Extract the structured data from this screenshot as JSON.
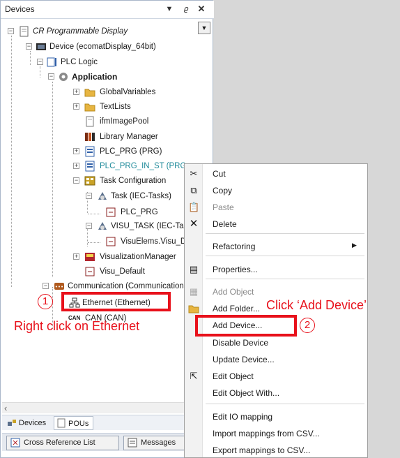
{
  "panel": {
    "title": "Devices",
    "pin_icon": "pin-icon",
    "close_icon": "close-icon",
    "menu_icon": "dropdown-arrow-icon"
  },
  "tree": {
    "root": "CR Programmable Display",
    "device": "Device (ecomatDisplay_64bit)",
    "plc_logic": "PLC Logic",
    "application": "Application",
    "global_vars": "GlobalVariables",
    "textlists": "TextLists",
    "image_pool": "ifmImagePool",
    "library_manager": "Library Manager",
    "plc_prg": "PLC_PRG (PRG)",
    "plc_prg_in_st": "PLC_PRG_IN_ST (PRG)",
    "task_config": "Task Configuration",
    "task": "Task (IEC-Tasks)",
    "task_plc_prg": "PLC_PRG",
    "visu_task": "VISU_TASK (IEC-Tasks)",
    "visu_elems": "VisuElems.Visu_Default",
    "visu_manager": "VisualizationManager",
    "visu_default": "Visu_Default",
    "communication": "Communication (Communication)",
    "ethernet": "Ethernet (Ethernet)",
    "can": "CAN (CAN)"
  },
  "bottom": {
    "tab_devices": "Devices",
    "tab_pous": "POUs",
    "tab_crossref": "Cross Reference List",
    "tab_messages": "Messages"
  },
  "context_menu": {
    "cut": "Cut",
    "copy": "Copy",
    "paste": "Paste",
    "delete": "Delete",
    "refactoring": "Refactoring",
    "properties": "Properties...",
    "add_object": "Add Object",
    "add_folder": "Add Folder...",
    "add_device": "Add Device...",
    "disable_device": "Disable Device",
    "update_device": "Update Device...",
    "edit_object": "Edit Object",
    "edit_object_with": "Edit Object With...",
    "edit_io_mapping": "Edit IO mapping",
    "import_mappings": "Import mappings from CSV...",
    "export_mappings": "Export mappings to CSV..."
  },
  "annotations": {
    "step1_num": "1",
    "step1_text": "Right click on Ethernet",
    "step2_num": "2",
    "step2_text": "Click ‘Add Device’",
    "color": "#e8111b"
  }
}
